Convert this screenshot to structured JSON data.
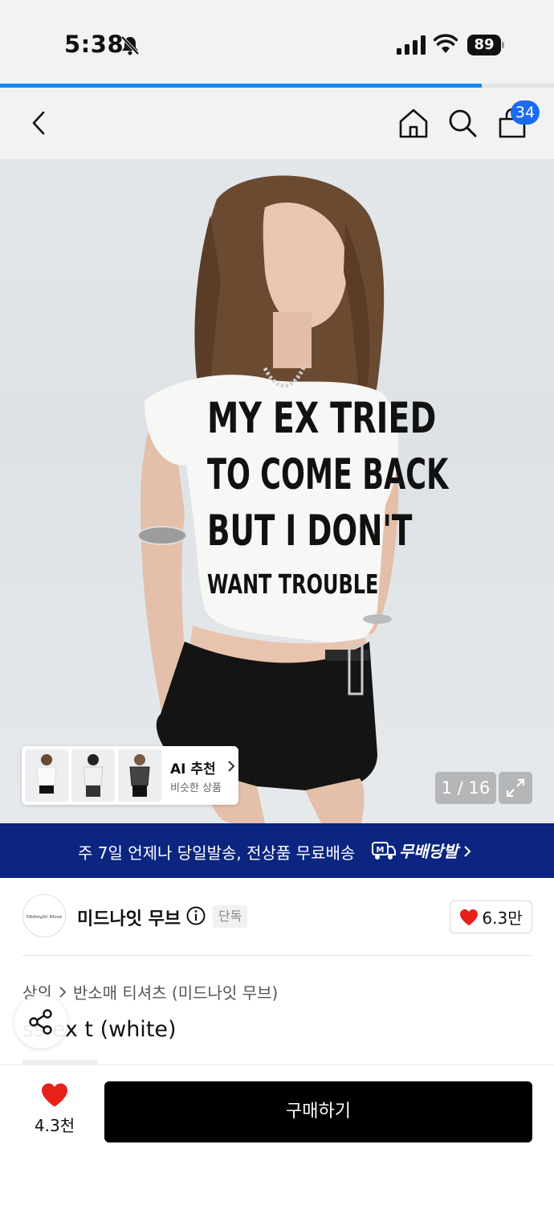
{
  "status_bar": {
    "time": "5:38",
    "battery": "89"
  },
  "progress": 0.87,
  "header": {
    "cart_count": "34"
  },
  "hero": {
    "shirt_text": [
      "MY EX TRIED",
      "TO COME BACK",
      "BUT I DON'T",
      "WANT TROUBLE"
    ],
    "ai_recommend": {
      "title": "AI 추천",
      "subtitle": "비슷한 상품"
    },
    "counter": "1 / 16"
  },
  "banner": {
    "text": "주 7일 언제나 당일발송, 전상품 무료배송",
    "logo_text": "무배당발"
  },
  "brand": {
    "name": "미드나잇 무브",
    "logo_script": "Midnight Move",
    "exclusive_tag": "단독",
    "likes": "6.3만"
  },
  "breadcrumb": {
    "category": "상의",
    "subcategory": "반소매 티셔츠 (미드나잇 무브)"
  },
  "product": {
    "title": "ss ex t (white)"
  },
  "bottom_bar": {
    "wish_count": "4.3천",
    "buy_label": "구매하기"
  },
  "colors": {
    "accent_blue": "#1a86f0",
    "badge_blue": "#1a6cf0",
    "banner_navy": "#0b2580",
    "heart_red": "#e8201a",
    "buy_black": "#000000"
  }
}
